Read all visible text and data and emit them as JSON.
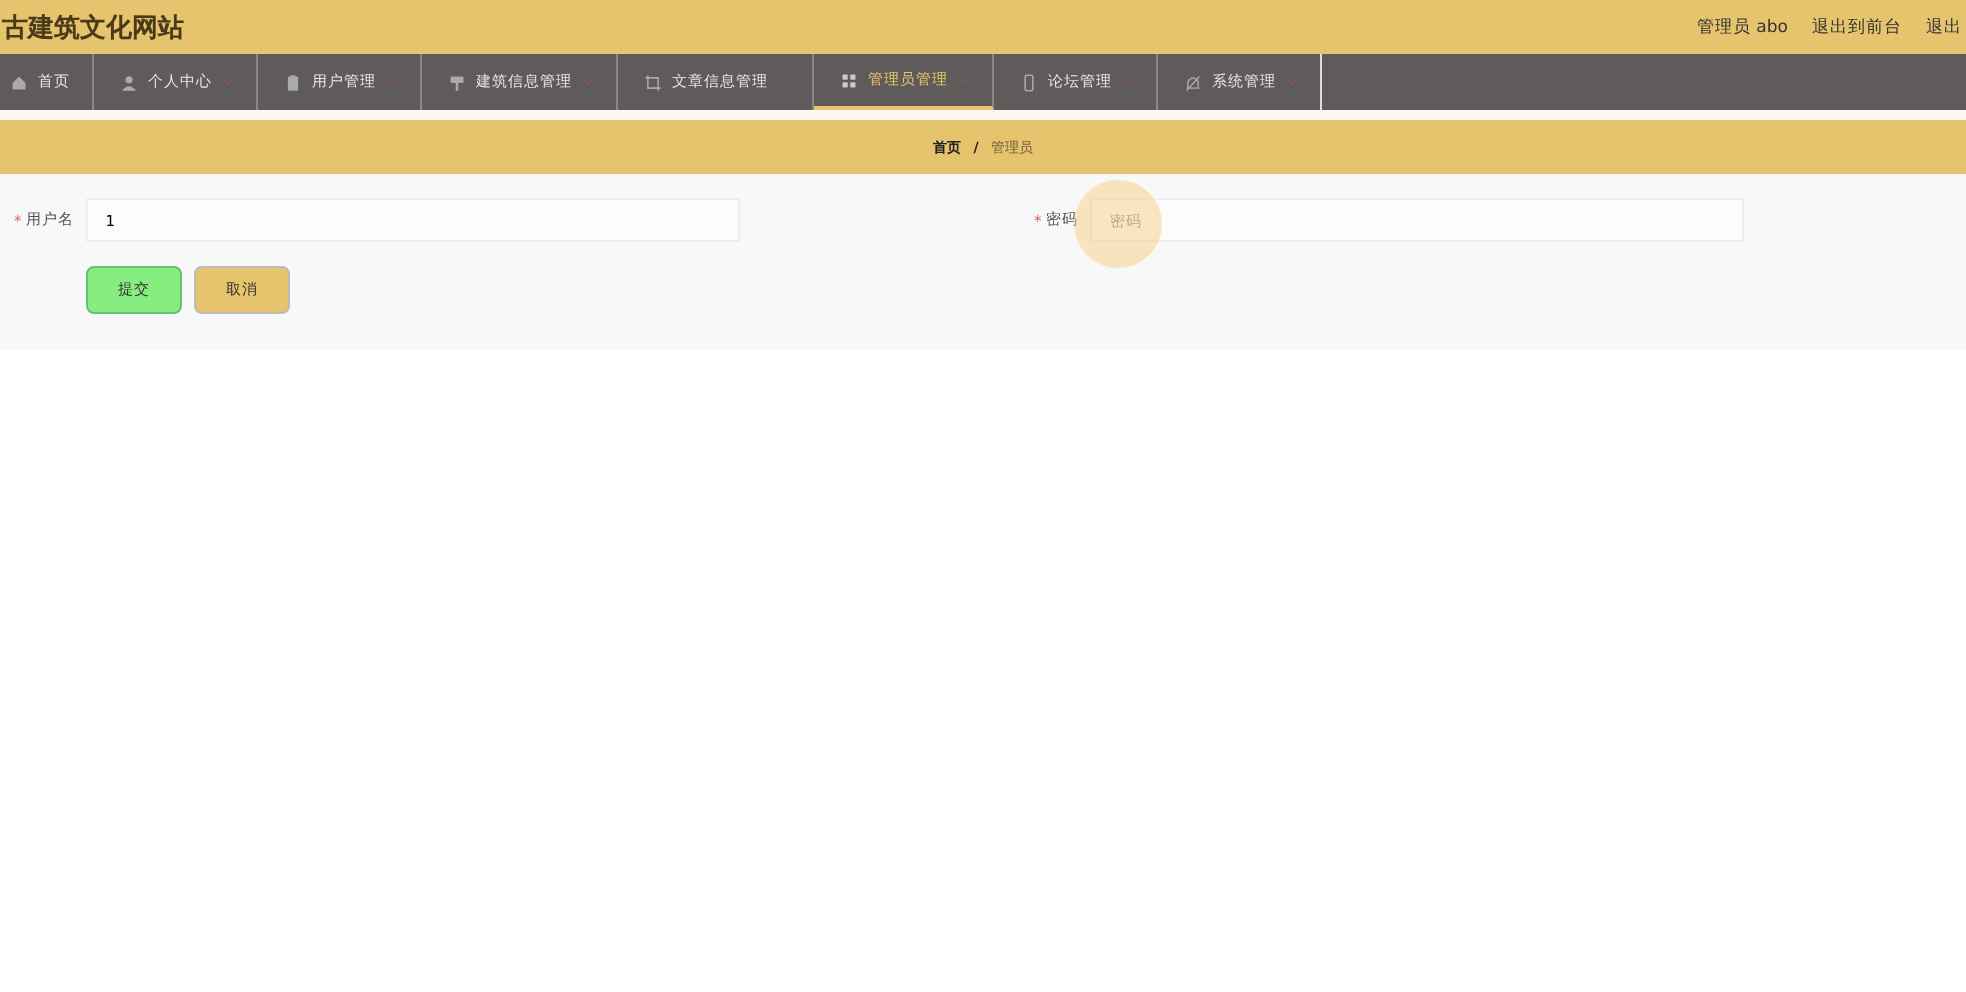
{
  "header": {
    "title": "古建筑文化网站",
    "links": [
      "管理员 abo",
      "退出到前台",
      "退出"
    ]
  },
  "nav": [
    {
      "label": "首页",
      "dropdown": false,
      "selected": false
    },
    {
      "label": "个人中心",
      "dropdown": true,
      "selected": false
    },
    {
      "label": "用户管理",
      "dropdown": true,
      "selected": false
    },
    {
      "label": "建筑信息管理",
      "dropdown": true,
      "selected": false
    },
    {
      "label": "文章信息管理",
      "dropdown": true,
      "selected": false
    },
    {
      "label": "管理员管理",
      "dropdown": true,
      "selected": true
    },
    {
      "label": "论坛管理",
      "dropdown": true,
      "selected": false
    },
    {
      "label": "系统管理",
      "dropdown": true,
      "selected": false
    }
  ],
  "breadcrumb_separator": "/",
  "breadcrumb": [
    {
      "label": "首页",
      "current": false
    },
    {
      "label": "管理员",
      "current": true
    }
  ],
  "form": {
    "required_mark": "*",
    "fields": [
      {
        "label": "用户名",
        "required": true,
        "value": "1"
      },
      {
        "label": "密码",
        "required": true,
        "placeholder": "密码",
        "focused": true
      }
    ],
    "buttons": [
      {
        "label": "提交",
        "kind": "submit"
      },
      {
        "label": "取消",
        "kind": "cancel"
      }
    ]
  }
}
